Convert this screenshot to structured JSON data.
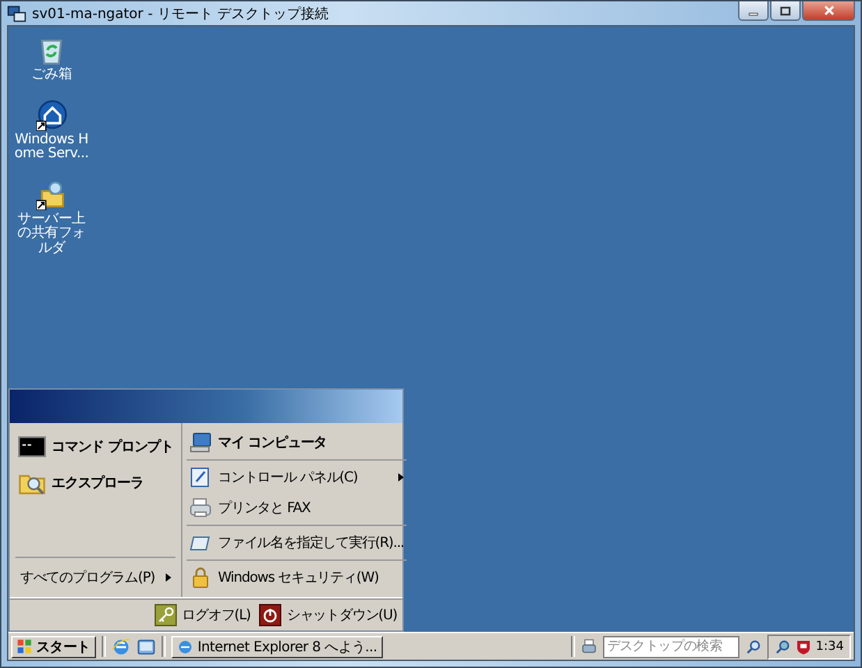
{
  "window": {
    "title": "sv01-ma-ngator - リモート デスクトップ接続"
  },
  "desktop_icons": [
    {
      "label": "ごみ箱",
      "kind": "recycle"
    },
    {
      "label": "Windows Home Serv...",
      "kind": "home"
    },
    {
      "label": "サーバー上の共有フォルダ",
      "kind": "share"
    }
  ],
  "start_menu": {
    "left_items": [
      {
        "label": "コマンド プロンプト",
        "kind": "cmd"
      },
      {
        "label": "エクスプローラ",
        "kind": "explorer"
      }
    ],
    "all_programs": {
      "label": "すべてのプログラム(P)",
      "submenu": true
    },
    "right_groups": [
      [
        {
          "label": "マイ コンピュータ",
          "kind": "computer",
          "bold": true,
          "submenu": false
        }
      ],
      [
        {
          "label": "コントロール パネル(C)",
          "kind": "control",
          "bold": false,
          "submenu": true
        },
        {
          "label": "プリンタと FAX",
          "kind": "printer",
          "bold": false,
          "submenu": false
        }
      ],
      [
        {
          "label": "ファイル名を指定して実行(R)...",
          "kind": "run",
          "bold": false,
          "submenu": false
        }
      ],
      [
        {
          "label": "Windows セキュリティ(W)",
          "kind": "security",
          "bold": false,
          "submenu": false
        }
      ]
    ],
    "bottom_buttons": [
      {
        "label": "ログオフ(L)",
        "kind": "logoff"
      },
      {
        "label": "シャットダウン(U)",
        "kind": "shutdown"
      }
    ]
  },
  "taskbar": {
    "start": "スタート",
    "tasks": [
      {
        "label": "Internet Explorer 8 へよう..."
      }
    ],
    "search": {
      "placeholder": "デスクトップの検索"
    },
    "clock": "1:34"
  }
}
